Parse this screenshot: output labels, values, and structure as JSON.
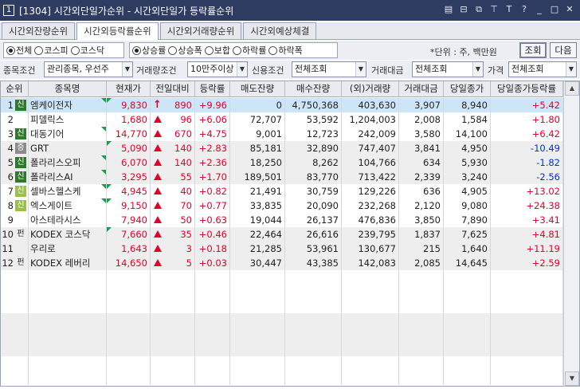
{
  "window": {
    "number": "1",
    "title": "[1304] 시간외단일가순위 - 시간외단일가 등락률순위",
    "icons": [
      "memo-icon",
      "window-icon",
      "copy-icon",
      "pin-icon",
      "text-icon",
      "help-icon",
      "minimize-icon",
      "maximize-icon",
      "close-icon"
    ]
  },
  "tabs": [
    {
      "label": "시간외잔량순위",
      "active": false
    },
    {
      "label": "시간외등락률순위",
      "active": true
    },
    {
      "label": "시간외거래량순위",
      "active": false
    },
    {
      "label": "시간외예상체결",
      "active": false
    }
  ],
  "market_filter": [
    {
      "label": "전체",
      "selected": true
    },
    {
      "label": "코스피",
      "selected": false
    },
    {
      "label": "코스닥",
      "selected": false
    }
  ],
  "rank_filter": [
    {
      "label": "상승률",
      "selected": true
    },
    {
      "label": "상승폭",
      "selected": false
    },
    {
      "label": "보합",
      "selected": false
    },
    {
      "label": "하락률",
      "selected": false
    },
    {
      "label": "하락폭",
      "selected": false
    }
  ],
  "unit_label": "*단위 : 주, 백만원",
  "buttons": {
    "query": "조회",
    "next": "다음"
  },
  "conditions": {
    "stock_label": "종목조건",
    "stock_value": "관리종목, 우선주",
    "volume_label": "거래량조건",
    "volume_value": "10만주이상",
    "credit_label": "신용조건",
    "credit_value": "전체조회",
    "amount_label": "거래대금",
    "amount_value": "전체조회",
    "price_label": "가격",
    "price_value": "전체조회"
  },
  "columns": [
    "순위",
    "종목명",
    "현재가",
    "전일대비",
    "등락률",
    "매도잔량",
    "매수잔량",
    "(외)거래량",
    "거래대금",
    "당일종가",
    "당일종가등락률"
  ],
  "rows": [
    {
      "rank": "1",
      "badge": "신",
      "badge_type": "g",
      "name": "엠케이전자",
      "price": "9,830",
      "arrow": "upper",
      "change": "890",
      "rate": "+9.96",
      "sell": "0",
      "buy": "4,750,368",
      "volume": "403,630",
      "amount": "3,907",
      "close": "8,940",
      "close_rate": "+5.42",
      "close_rate_sign": "up",
      "selected": true
    },
    {
      "rank": "2",
      "badge": "",
      "badge_type": "",
      "name": "피델릭스",
      "price": "1,680",
      "arrow": "up",
      "change": "96",
      "rate": "+6.06",
      "sell": "72,707",
      "buy": "53,592",
      "volume": "1,204,003",
      "amount": "2,008",
      "close": "1,584",
      "close_rate": "+1.80",
      "close_rate_sign": "up",
      "selected": false
    },
    {
      "rank": "3",
      "badge": "신",
      "badge_type": "g",
      "name": "대동기어",
      "price": "14,770",
      "arrow": "up",
      "change": "670",
      "rate": "+4.75",
      "sell": "9,001",
      "buy": "12,723",
      "volume": "242,009",
      "amount": "3,580",
      "close": "14,100",
      "close_rate": "+6.42",
      "close_rate_sign": "up",
      "selected": false
    },
    {
      "rank": "4",
      "badge": "증",
      "badge_type": "gr",
      "name": "GRT",
      "price": "5,090",
      "arrow": "up",
      "change": "140",
      "rate": "+2.83",
      "sell": "85,181",
      "buy": "32,890",
      "volume": "747,407",
      "amount": "3,841",
      "close": "4,950",
      "close_rate": "-10.49",
      "close_rate_sign": "down",
      "selected": false
    },
    {
      "rank": "5",
      "badge": "신",
      "badge_type": "g",
      "name": "폴라리스오피",
      "price": "6,070",
      "arrow": "up",
      "change": "140",
      "rate": "+2.36",
      "sell": "18,250",
      "buy": "8,262",
      "volume": "104,766",
      "amount": "634",
      "close": "5,930",
      "close_rate": "-1.82",
      "close_rate_sign": "down",
      "selected": false
    },
    {
      "rank": "6",
      "badge": "신",
      "badge_type": "g",
      "name": "폴라리스AI",
      "price": "3,295",
      "arrow": "up",
      "change": "55",
      "rate": "+1.70",
      "sell": "189,501",
      "buy": "83,770",
      "volume": "713,422",
      "amount": "2,339",
      "close": "3,240",
      "close_rate": "-2.56",
      "close_rate_sign": "down",
      "selected": false
    },
    {
      "rank": "7",
      "badge": "신",
      "badge_type": "lg",
      "name": "셀바스헬스케",
      "price": "4,945",
      "arrow": "up",
      "change": "40",
      "rate": "+0.82",
      "sell": "21,491",
      "buy": "30,759",
      "volume": "129,226",
      "amount": "636",
      "close": "4,905",
      "close_rate": "+13.02",
      "close_rate_sign": "up",
      "selected": false
    },
    {
      "rank": "8",
      "badge": "신",
      "badge_type": "lg",
      "name": "엑스게이트",
      "price": "9,150",
      "arrow": "up",
      "change": "70",
      "rate": "+0.77",
      "sell": "33,835",
      "buy": "20,090",
      "volume": "232,268",
      "amount": "2,120",
      "close": "9,080",
      "close_rate": "+24.38",
      "close_rate_sign": "up",
      "selected": false
    },
    {
      "rank": "9",
      "badge": "",
      "badge_type": "",
      "name": "아스테라시스",
      "price": "7,940",
      "arrow": "up",
      "change": "50",
      "rate": "+0.63",
      "sell": "19,044",
      "buy": "26,137",
      "volume": "476,836",
      "amount": "3,850",
      "close": "7,890",
      "close_rate": "+3.41",
      "close_rate_sign": "up",
      "selected": false
    },
    {
      "rank": "10",
      "badge": "펀",
      "badge_type": "t",
      "name": "KODEX 코스닥",
      "price": "7,660",
      "arrow": "up",
      "change": "35",
      "rate": "+0.46",
      "sell": "22,464",
      "buy": "26,616",
      "volume": "239,795",
      "amount": "1,837",
      "close": "7,625",
      "close_rate": "+4.81",
      "close_rate_sign": "up",
      "selected": false
    },
    {
      "rank": "11",
      "badge": "",
      "badge_type": "",
      "name": "우리로",
      "price": "1,643",
      "arrow": "up",
      "change": "3",
      "rate": "+0.18",
      "sell": "21,285",
      "buy": "53,961",
      "volume": "130,677",
      "amount": "215",
      "close": "1,640",
      "close_rate": "+11.19",
      "close_rate_sign": "up",
      "selected": false
    },
    {
      "rank": "12",
      "badge": "펀",
      "badge_type": "t",
      "name": "KODEX 레버리",
      "price": "14,650",
      "arrow": "up",
      "change": "5",
      "rate": "+0.03",
      "sell": "30,447",
      "buy": "43,385",
      "volume": "142,083",
      "amount": "2,085",
      "close": "14,645",
      "close_rate": "+2.59",
      "close_rate_sign": "up",
      "selected": false
    }
  ],
  "colors": {
    "up": "#e0002a",
    "down": "#0033cc",
    "selected_row": "#cde6f7",
    "alt_row": "#eeeeee",
    "title_bar": "#2f3c62"
  }
}
